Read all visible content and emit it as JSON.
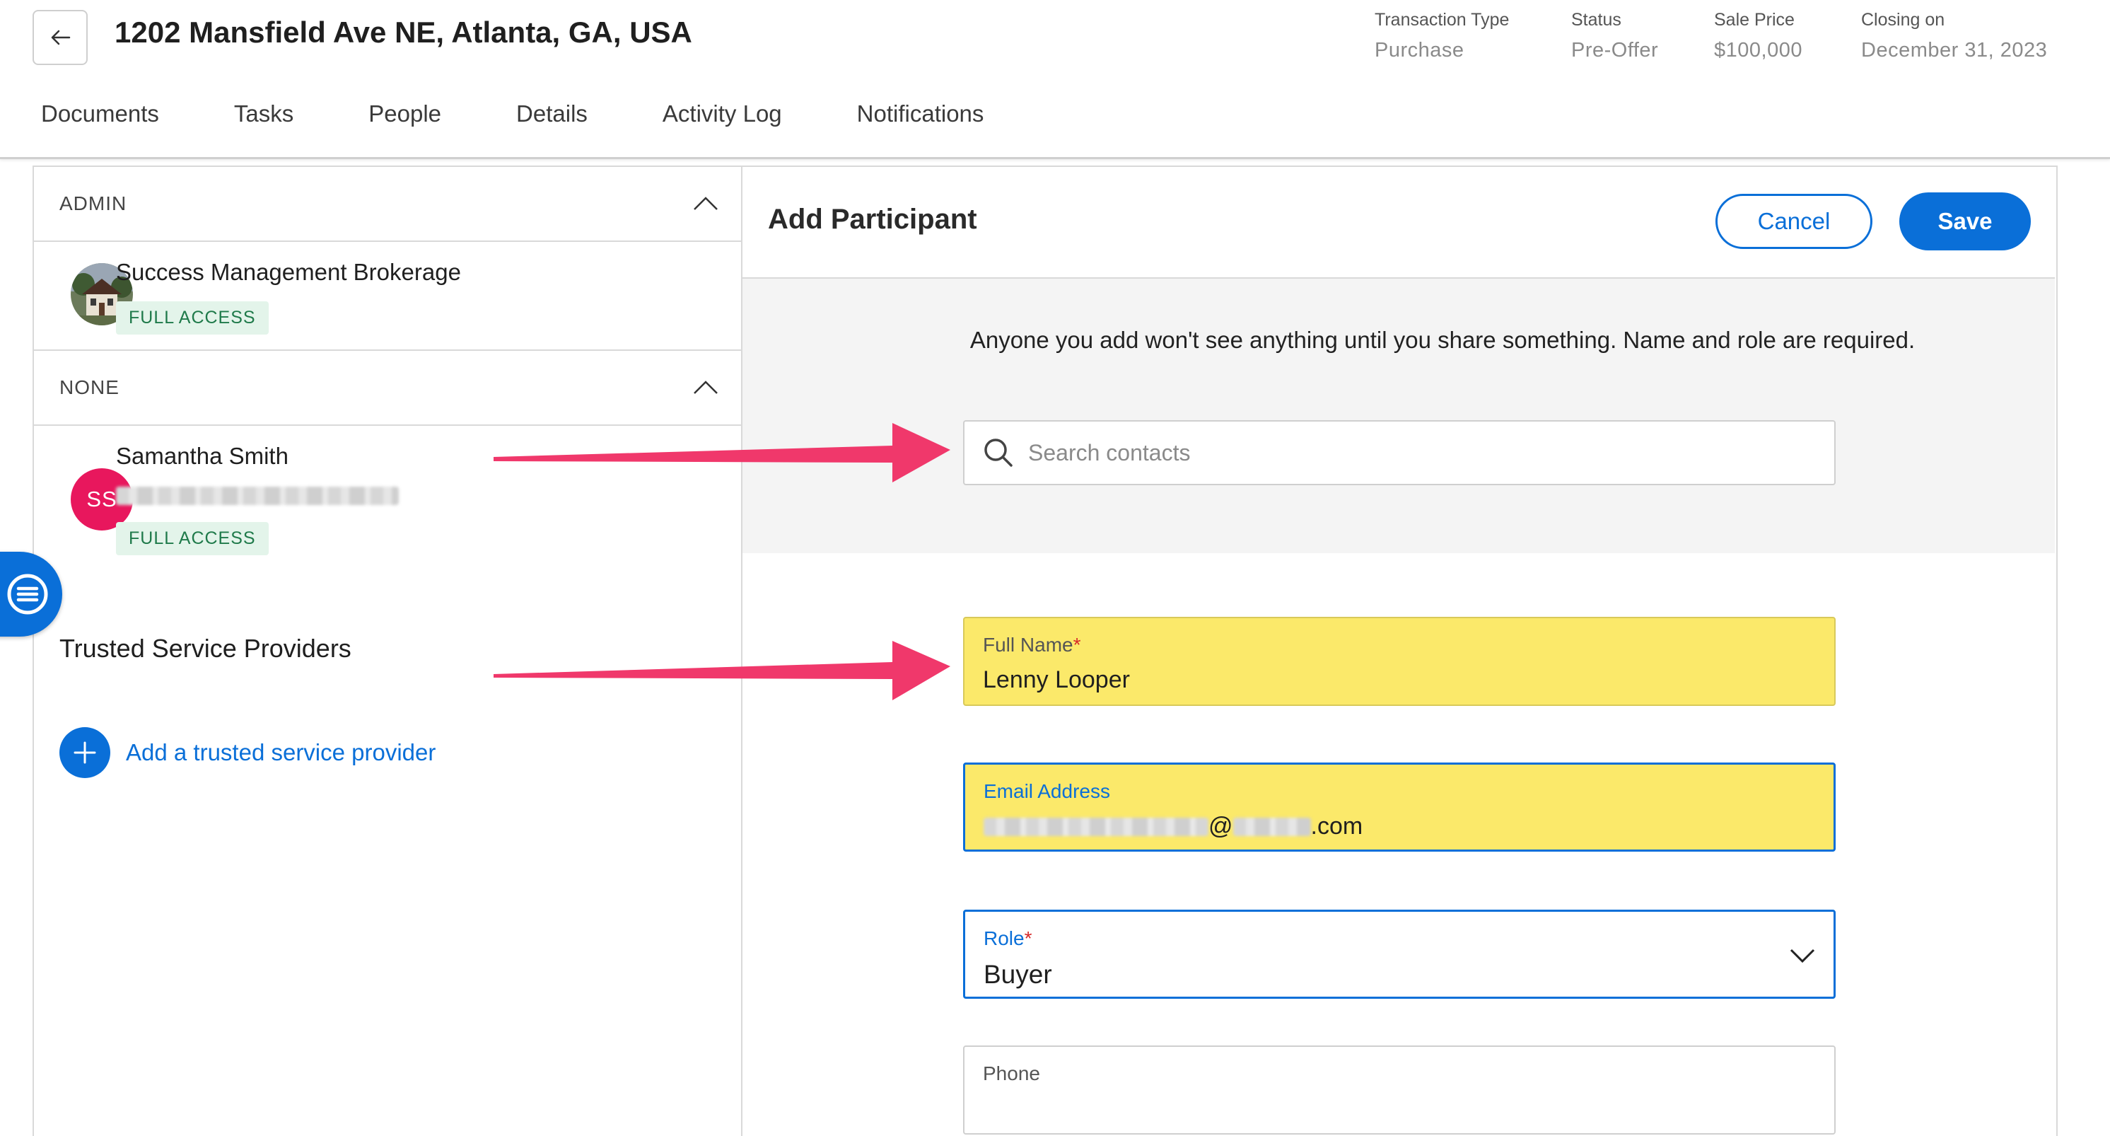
{
  "header": {
    "title": "1202 Mansfield Ave NE, Atlanta, GA, USA",
    "meta": [
      {
        "label": "Transaction Type",
        "value": "Purchase"
      },
      {
        "label": "Status",
        "value": "Pre-Offer"
      },
      {
        "label": "Sale Price",
        "value": "$100,000"
      },
      {
        "label": "Closing on",
        "value": "December 31, 2023"
      }
    ],
    "tabs": [
      "Documents",
      "Tasks",
      "People",
      "Details",
      "Activity Log",
      "Notifications"
    ]
  },
  "left": {
    "admin_section": "ADMIN",
    "admin_person": {
      "name": "Success Management Brokerage",
      "badge": "FULL ACCESS"
    },
    "none_section": "NONE",
    "none_person": {
      "name": "Samantha Smith",
      "initials": "SS",
      "badge": "FULL ACCESS"
    },
    "tsp_title": "Trusted Service Providers",
    "add_tsp": "Add a trusted service provider"
  },
  "form": {
    "title": "Add Participant",
    "cancel": "Cancel",
    "save": "Save",
    "info": "Anyone you add won't see anything until you share something. Name and role are required.",
    "search_placeholder": "Search contacts",
    "full_name_label": "Full Name",
    "full_name_value": "Lenny Looper",
    "email_label": "Email Address",
    "email_value_suffix": "@",
    "email_value_tld": ".com",
    "role_label": "Role",
    "role_value": "Buyer",
    "phone_label": "Phone",
    "required_mark": "*"
  },
  "colors": {
    "accent": "#0a6fd8",
    "highlight": "#fbe96a",
    "arrow": "#f0386b",
    "badge_bg": "#e3f4ea",
    "avatar_ss": "#e8175d"
  },
  "icons": [
    "back-arrow-icon",
    "chevron-up-icon",
    "search-icon",
    "plus-icon",
    "chat-icon",
    "chevron-down-icon",
    "house-icon"
  ]
}
